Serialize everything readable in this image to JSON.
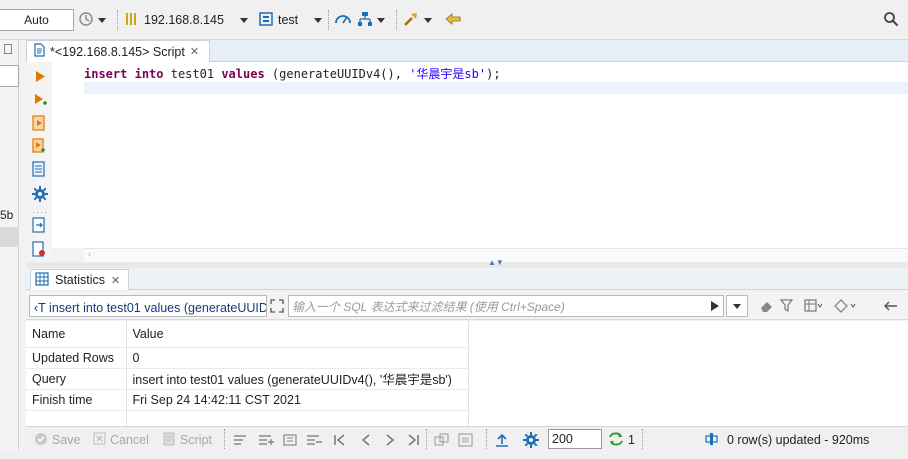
{
  "toolbar": {
    "mode": "Auto",
    "connection": "192.168.8.145",
    "database": "test"
  },
  "left_strip": {
    "clipped_label": "5b"
  },
  "editor": {
    "tab_title": "*<192.168.8.145> Script",
    "code": {
      "kw1": "insert",
      "kw2": "into",
      "table": "test01",
      "kw3": "values",
      "call": "(generateUUIDv4(), ",
      "literal": "'华晨宇是sb'",
      "end": ");"
    }
  },
  "results": {
    "tab_title": "Statistics",
    "query_preview": "‹T insert into test01 values (generateUUIDv4(), '华晨宇是sb')",
    "filter_placeholder": "输入一个 SQL 表达式来过滤结果 (使用 Ctrl+Space)",
    "columns": [
      "Name",
      "Value"
    ],
    "rows": [
      {
        "name": "Updated Rows",
        "value": "0"
      },
      {
        "name": "Query",
        "value": "insert into test01 values (generateUUIDv4(), '华晨宇是sb')"
      },
      {
        "name": "Finish time",
        "value": "Fri Sep 24 14:42:11 CST 2021"
      }
    ]
  },
  "statusbar": {
    "save": "Save",
    "cancel": "Cancel",
    "script": "Script",
    "fetch_size": "200",
    "refresh_count": "1",
    "message": "0 row(s) updated - 920ms"
  },
  "icons": {
    "history": "history-icon",
    "connection": "database-connection-icon",
    "schema": "schema-icon",
    "dashboard": "dashboard-icon",
    "network": "network-icon",
    "tools": "tools-icon",
    "search": "search-icon"
  },
  "colors": {
    "accent": "#1c6fb5",
    "keyword": "#7f0055",
    "string": "#2a00ff",
    "run": "#e07b00",
    "refresh": "#2a9a2a"
  }
}
